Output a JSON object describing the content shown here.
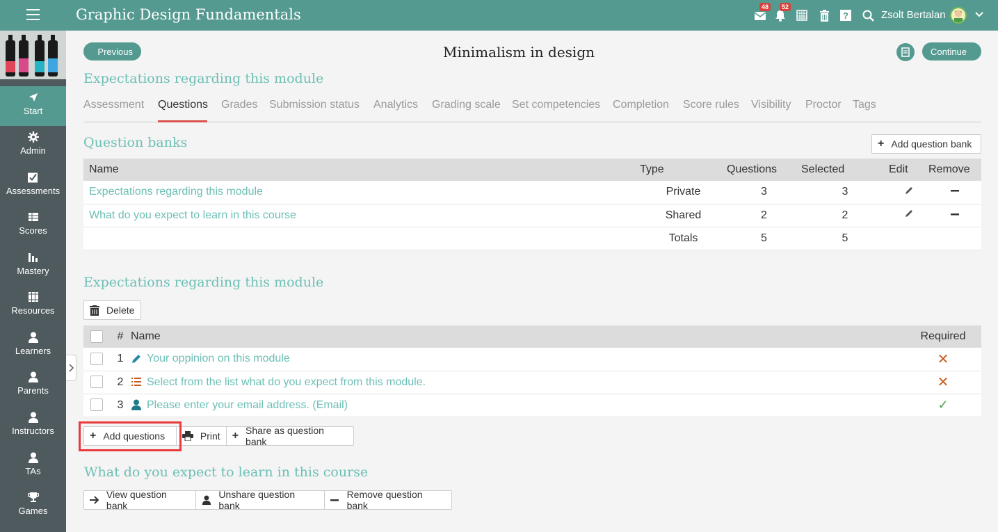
{
  "header": {
    "title": "Graphic Design Fundamentals",
    "messages_badge": "48",
    "notifications_badge": "52",
    "user_name": "Zsolt Bertalan"
  },
  "sidebar": {
    "items": [
      {
        "label": "Start",
        "icon": "navigate-icon"
      },
      {
        "label": "Admin",
        "icon": "gear-icon"
      },
      {
        "label": "Assessments",
        "icon": "checkbox-icon"
      },
      {
        "label": "Scores",
        "icon": "table-icon"
      },
      {
        "label": "Mastery",
        "icon": "bar-chart-icon"
      },
      {
        "label": "Resources",
        "icon": "books-icon"
      },
      {
        "label": "Learners",
        "icon": "person-icon"
      },
      {
        "label": "Parents",
        "icon": "person-icon"
      },
      {
        "label": "Instructors",
        "icon": "person-icon"
      },
      {
        "label": "TAs",
        "icon": "person-icon"
      },
      {
        "label": "Games",
        "icon": "trophy-icon"
      }
    ]
  },
  "nav": {
    "previous": "Previous",
    "continue": "Continue",
    "page_title": "Minimalism in design"
  },
  "module_title": "Expectations regarding this module",
  "tabs": [
    "Assessment",
    "Questions",
    "Grades",
    "Submission status",
    "Analytics",
    "Grading scale",
    "Set competencies",
    "Completion",
    "Score rules",
    "Visibility",
    "Proctor",
    "Tags"
  ],
  "question_banks": {
    "title": "Question banks",
    "add_button": "Add question bank",
    "columns": [
      "Name",
      "Type",
      "Questions",
      "Selected",
      "Edit",
      "Remove"
    ],
    "rows": [
      {
        "name": "Expectations regarding this module",
        "type": "Private",
        "questions": "3",
        "selected": "3"
      },
      {
        "name": "What do you expect to learn in this course",
        "type": "Shared",
        "questions": "2",
        "selected": "2"
      }
    ],
    "totals_label": "Totals",
    "totals_questions": "5",
    "totals_selected": "5"
  },
  "bank1": {
    "title": "Expectations regarding this module",
    "delete_button": "Delete",
    "columns": [
      "#",
      "Name",
      "Required"
    ],
    "rows": [
      {
        "num": "1",
        "name": "Your oppinion on this module",
        "required": false
      },
      {
        "num": "2",
        "name": "Select from the list what do you expect from this module.",
        "required": false
      },
      {
        "num": "3",
        "name": "Please enter your email address. (Email)",
        "required": true
      }
    ],
    "add_questions": "Add questions",
    "print": "Print",
    "share": "Share as question bank"
  },
  "bank2": {
    "title": "What do you expect to learn in this course",
    "view": "View question bank",
    "unshare": "Unshare question bank",
    "remove": "Remove question bank"
  },
  "colors": {
    "accent": "#559a90",
    "link": "#6cbfb5",
    "sidebar": "#4e5a5e",
    "highlight": "#e8393c"
  }
}
